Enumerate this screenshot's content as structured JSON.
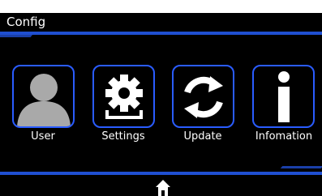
{
  "window": {
    "title": "Config"
  },
  "tiles": [
    {
      "label": "User",
      "icon": "user-silhouette-icon"
    },
    {
      "label": "Settings",
      "icon": "gear-icon"
    },
    {
      "label": "Update",
      "icon": "refresh-icon"
    },
    {
      "label": "Infomation",
      "icon": "info-icon"
    }
  ],
  "nav": {
    "home_icon": "home-icon"
  },
  "colors": {
    "accent": "#1f4fd1",
    "tile_border": "#2a5cff",
    "background": "#000000",
    "user_icon": "#a9a9a9"
  }
}
